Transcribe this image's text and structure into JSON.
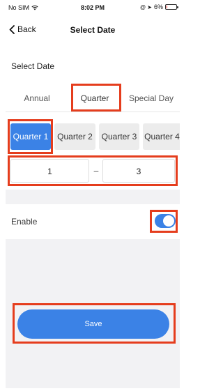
{
  "status_bar": {
    "carrier": "No SIM",
    "time": "8:02 PM",
    "battery_text": "6%",
    "battery_fraction": 0.06
  },
  "nav": {
    "back_label": "Back",
    "title": "Select Date"
  },
  "section": {
    "title": "Select Date"
  },
  "tabs": [
    {
      "label": "Annual"
    },
    {
      "label": "Quarter",
      "selected": true
    },
    {
      "label": "Special Day"
    }
  ],
  "quarters": [
    {
      "label": "Quarter 1",
      "selected": true
    },
    {
      "label": "Quarter 2"
    },
    {
      "label": "Quarter 3"
    },
    {
      "label": "Quarter 4"
    }
  ],
  "range": {
    "start": "1",
    "separator": "–",
    "end": "3"
  },
  "enable": {
    "label": "Enable",
    "on": true
  },
  "save_label": "Save",
  "colors": {
    "accent": "#3b82e6",
    "highlight": "#e53d1d"
  }
}
